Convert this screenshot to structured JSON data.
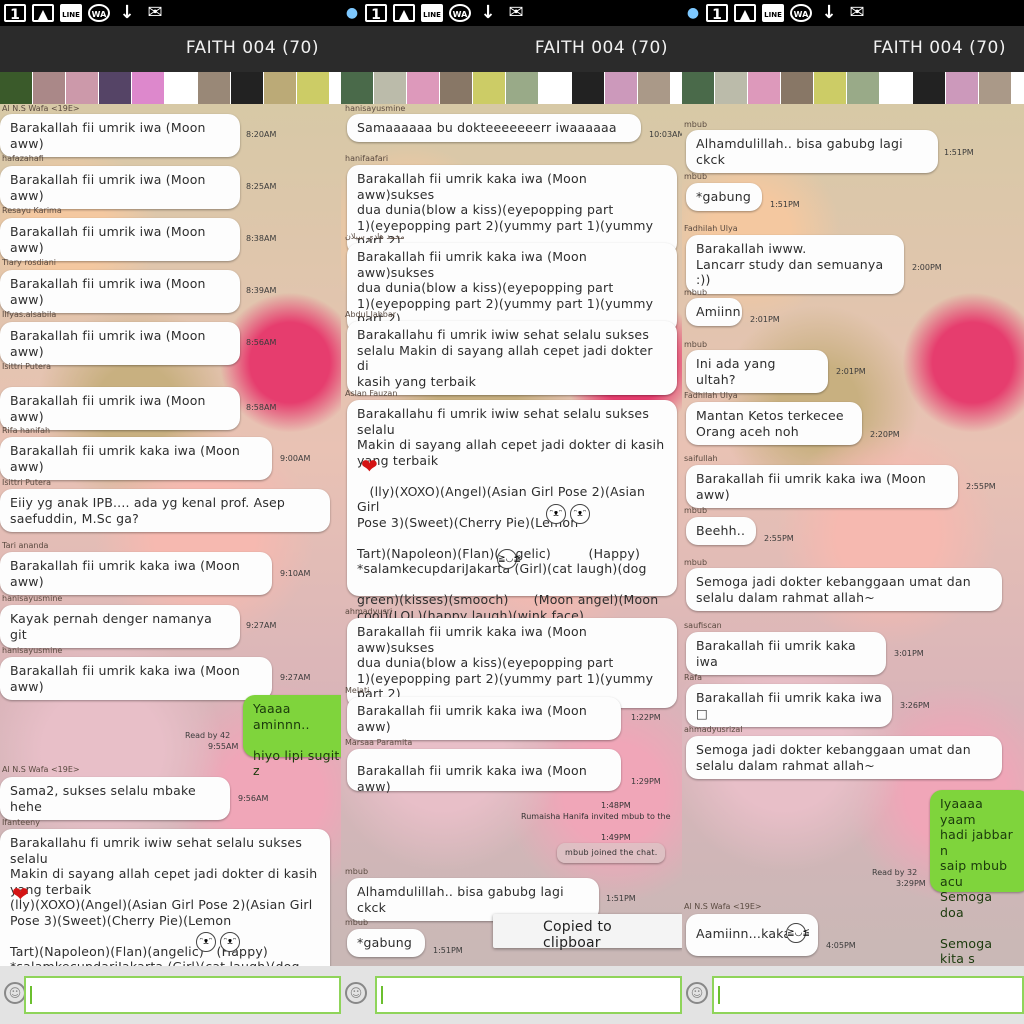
{
  "title": "FAITH 004 (70)",
  "status_icons": [
    "1",
    "LINE",
    "WA",
    "↓",
    "✉"
  ],
  "colors": {
    "accent_green": "#7fd43c",
    "titlebar": "#2b2b2b",
    "bubble": "#fdfdfd"
  },
  "panels": [
    {
      "messages": [
        {
          "sender": "Al N.S Wafa <19E>",
          "text": "Barakallah fii umrik iwa (Moon aww)",
          "time": "8:20AM"
        },
        {
          "sender": "hafazahafi",
          "text": "Barakallah fii umrik iwa (Moon aww)",
          "time": "8:25AM"
        },
        {
          "sender": "Resayu Karima",
          "text": "Barakallah fii umrik iwa (Moon aww)",
          "time": "8:38AM"
        },
        {
          "sender": "Tiary rosdiani",
          "text": "Barakallah fii umrik iwa (Moon aww)",
          "time": "8:39AM"
        },
        {
          "sender": "Ilfyas.alsabila",
          "text": "Barakallah fii umrik iwa (Moon aww)",
          "time": "8:56AM"
        },
        {
          "sender": "Isittri Putera",
          "text": "Barakallah fii umrik iwa (Moon aww)",
          "time": "8:58AM"
        },
        {
          "sender": "Rifa hanifah",
          "text": "Barakallah fii umrik kaka iwa (Moon aww)",
          "time": "9:00AM"
        },
        {
          "sender": "Isittri Putera",
          "text": "Eiiy yg anak IPB.... ada yg kenal prof. Asep\nsaefuddin, M.Sc ga?",
          "time": ""
        },
        {
          "sender": "Tari ananda",
          "text": "Barakallah fii umrik kaka iwa (Moon aww)",
          "time": "9:10AM"
        },
        {
          "sender": "hanisayusmine",
          "text": "Kayak pernah denger namanya git",
          "time": "9:27AM"
        },
        {
          "sender": "hanisayusmine",
          "text": "Barakallah fii umrik kaka iwa (Moon aww)",
          "time": "9:27AM"
        },
        {
          "sender": "",
          "text": "Yaaaa aminnn..\n\nhiyo lipi sugit z",
          "time": "9:55AM",
          "read": "Read by 42",
          "mine": true
        },
        {
          "sender": "Al N.S Wafa <19E>",
          "text": "Sama2, sukses selalu mbake hehe",
          "time": "9:56AM"
        },
        {
          "sender": "Ifanteeny",
          "text": "Barakallahu fi umrik iwiw sehat selalu sukses selalu\nMakin di sayang allah cepet jadi dokter di kasih\nyang terbaik\n(lly)(XOXO)(Angel)(Asian Girl Pose 2)(Asian Girl\nPose 3)(Sweet)(Cherry Pie)(Lemon\n\nTart)(Napoleon)(Flan)(angelic)   (Happy)\n*salamkecupdariJakarta (Girl)(cat laugh)(dog",
          "time": ""
        }
      ]
    },
    {
      "messages": [
        {
          "sender": "hanisayusmine",
          "text": "Samaaaaaa bu dokteeeeeeerr iwaaaaaa",
          "time": "10:03AM"
        },
        {
          "sender": "hanifaafari",
          "text": "Barakallah fii umrik kaka iwa (Moon aww)sukses\ndua dunia(blow a kiss)(eyepopping part\n1)(eyepopping part 2)(yummy part 1)(yummy part 2)",
          "time": ""
        },
        {
          "sender": "محمد هادي سيلان",
          "text": "Barakallah fii umrik kaka iwa (Moon aww)sukses\ndua dunia(blow a kiss)(eyepopping part\n1)(eyepopping part 2)(yummy part 1)(yummy part 2)",
          "time": ""
        },
        {
          "sender": "Abdul Jabbar",
          "text": "Barakallahu fi umrik iwiw sehat selalu sukses\nselalu Makin di sayang allah cepet jadi dokter di\nkasih yang terbaik",
          "time": ""
        },
        {
          "sender": "Aslan Fauzan",
          "text": "Barakallahu fi umrik iwiw sehat selalu sukses selalu\nMakin di sayang allah cepet jadi dokter di kasih\nyang terbaik\n\n   (lly)(XOXO)(Angel)(Asian Girl Pose 2)(Asian Girl\nPose 3)(Sweet)(Cherry Pie)(Lemon\n\nTart)(Napoleon)(Flan)(angelic)         (Happy)\n*salamkecupdariJakarta (Girl)(cat laugh)(dog\n\ngreen)(kisses)(smooch)      (Moon angel)(Moon\ncool)(LOL)(happy laugh)(wink face)",
          "time": ""
        },
        {
          "sender": "ahmadyusri",
          "text": "Barakallah fii umrik kaka iwa (Moon aww)sukses\ndua dunia(blow a kiss)(eyepopping part\n1)(eyepopping part 2)(yummy part 1)(yummy part 2)",
          "time": ""
        },
        {
          "sender": "Melati",
          "text": "Barakallah fii umrik kaka iwa (Moon aww)",
          "time": "1:22PM"
        },
        {
          "sender": "Marsaa Paramita",
          "text": "Barakallah fii umrik kaka iwa (Moon aww)",
          "time": "1:29PM"
        },
        {
          "sender": "",
          "text": "Rumaisha Hanifa invited mbub to the",
          "time": "1:48PM",
          "system": true
        },
        {
          "sender": "",
          "text": "mbub joined the chat.",
          "time": "1:49PM",
          "system": true
        },
        {
          "sender": "mbub",
          "text": "Alhamdulillah.. bisa gabubg lagi ckck",
          "time": "1:51PM"
        },
        {
          "sender": "mbub",
          "text": "*gabung",
          "time": "1:51PM"
        },
        {
          "sender": "",
          "text": "Copied to clipboar",
          "time": "",
          "toast": true
        }
      ]
    },
    {
      "messages": [
        {
          "sender": "mbub",
          "text": "Alhamdulillah.. bisa gabubg lagi ckck",
          "time": "1:51PM"
        },
        {
          "sender": "mbub",
          "text": "*gabung",
          "time": "1:51PM"
        },
        {
          "sender": "Fadhilah Ulya",
          "text": "Barakallah iwww.\nLancarr study dan semuanya :))",
          "time": "2:00PM"
        },
        {
          "sender": "mbub",
          "text": "Amiinn",
          "time": "2:01PM"
        },
        {
          "sender": "mbub",
          "text": "Ini ada yang ultah?",
          "time": "2:01PM"
        },
        {
          "sender": "Fadhilah Ulya",
          "text": "Mantan Ketos terkecee\nOrang aceh noh",
          "time": "2:20PM"
        },
        {
          "sender": "saifullah",
          "text": "Barakallah fii umrik kaka iwa (Moon aww)",
          "time": "2:55PM"
        },
        {
          "sender": "mbub",
          "text": "Beehh..",
          "time": "2:55PM"
        },
        {
          "sender": "mbub",
          "text": "Semoga jadi dokter kebanggaan umat dan\nselalu dalam rahmat allah~",
          "time": ""
        },
        {
          "sender": "saufiscan",
          "text": "Barakallah fii umrik kaka iwa",
          "time": "3:01PM"
        },
        {
          "sender": "Rafa",
          "text": "Barakallah fii umrik kaka iwa □",
          "time": "3:26PM"
        },
        {
          "sender": "ahmadyusrizal",
          "text": "Semoga jadi dokter kebanggaan umat dan\nselalu dalam rahmat allah~",
          "time": ""
        },
        {
          "sender": "",
          "text": "Iyaaaa yaam\nhadi jabbar n\nsaip mbub acu\nSemoga doa\n\nSemoga kita s",
          "time": "3:29PM",
          "read": "Read by 32",
          "mine": true
        },
        {
          "sender": "Al N.S Wafa <19E>",
          "text": "Aamiinn...kaka",
          "time": "4:05PM"
        }
      ]
    }
  ]
}
